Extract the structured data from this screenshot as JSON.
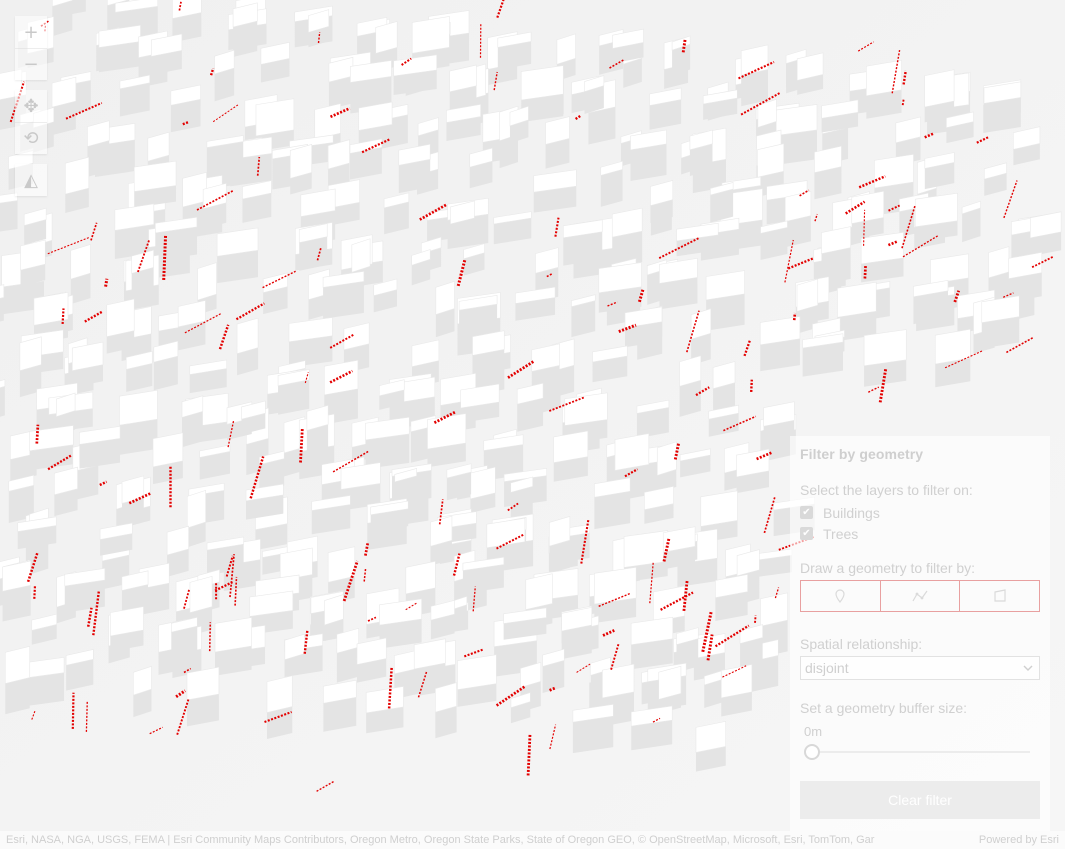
{
  "map": {
    "street_label_color": "#e30000",
    "building_color": "#ffffff",
    "building_shadow_color": "#e4e4e4",
    "ground_color": "#f2f2f2"
  },
  "navigation": {
    "zoom_in_icon": "+",
    "zoom_out_icon": "−",
    "pan_icon": "✥",
    "rotate_icon": "⟲",
    "compass_icon": "◭"
  },
  "filter_panel": {
    "title": "Filter by geometry",
    "layers_label": "Select the layers to filter on:",
    "layers": [
      {
        "label": "Buildings",
        "checked": true
      },
      {
        "label": "Trees",
        "checked": true
      }
    ],
    "draw_label": "Draw a geometry to filter by:",
    "draw_tools": [
      "point-icon",
      "polyline-icon",
      "polygon-icon"
    ],
    "relationship_label": "Spatial relationship:",
    "relationship_value": "disjoint",
    "buffer_label": "Set a geometry buffer size:",
    "buffer_value": "0m",
    "clear_button": "Clear filter"
  },
  "attribution": {
    "text": "Esri, NASA, NGA, USGS, FEMA | Esri Community Maps Contributors, Oregon Metro, Oregon State Parks, State of Oregon GEO, © OpenStreetMap, Microsoft, Esri, TomTom, Gar",
    "powered_by": "Powered by Esri"
  }
}
